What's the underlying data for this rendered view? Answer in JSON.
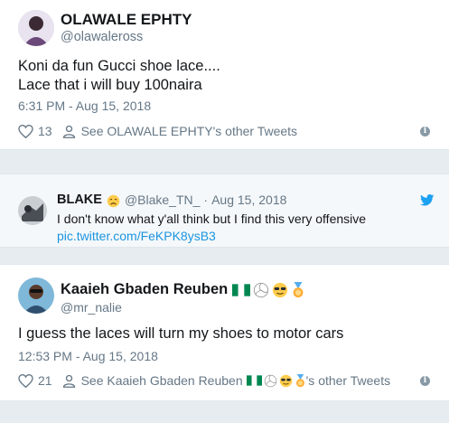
{
  "tweet": {
    "author_name": "OLAWALE EPHTY",
    "author_handle": "@olawaleross",
    "text_line1": "Koni da fun Gucci shoe lace....",
    "text_line2": "Lace that i will buy 100naira",
    "timestamp": "6:31 PM - Aug 15, 2018",
    "like_count": "13",
    "see_other": "See OLAWALE EPHTY's other Tweets"
  },
  "quoted": {
    "author_name": "BLAKE",
    "author_handle": "@Blake_TN_",
    "separator": "·",
    "date": "Aug 15, 2018",
    "text": "I don't know what y'all think but I find this very offensive",
    "link": "pic.twitter.com/FeKPK8ysB3"
  },
  "reply": {
    "author_name": "Kaaieh Gbaden Reuben",
    "author_handle": "@mr_nalie",
    "text": "I guess the laces will turn my shoes to motor cars",
    "timestamp": "12:53 PM - Aug 15, 2018",
    "like_count": "21",
    "see_other_prefix": "See Kaaieh Gbaden Reuben",
    "see_other_suffix": "'s other Tweets"
  },
  "icons": {
    "like": "heart-outline-icon",
    "profile": "person-outline-icon",
    "info": "info-icon",
    "twitter": "twitter-bird-icon",
    "flag": "nigeria-flag-icon",
    "ball": "volleyball-icon",
    "cool": "sunglasses-face-icon",
    "medal": "medal-icon",
    "weary": "weary-face-icon"
  },
  "colors": {
    "link": "#1b95e0",
    "muted": "#657786",
    "twitter_blue": "#1da1f2"
  }
}
